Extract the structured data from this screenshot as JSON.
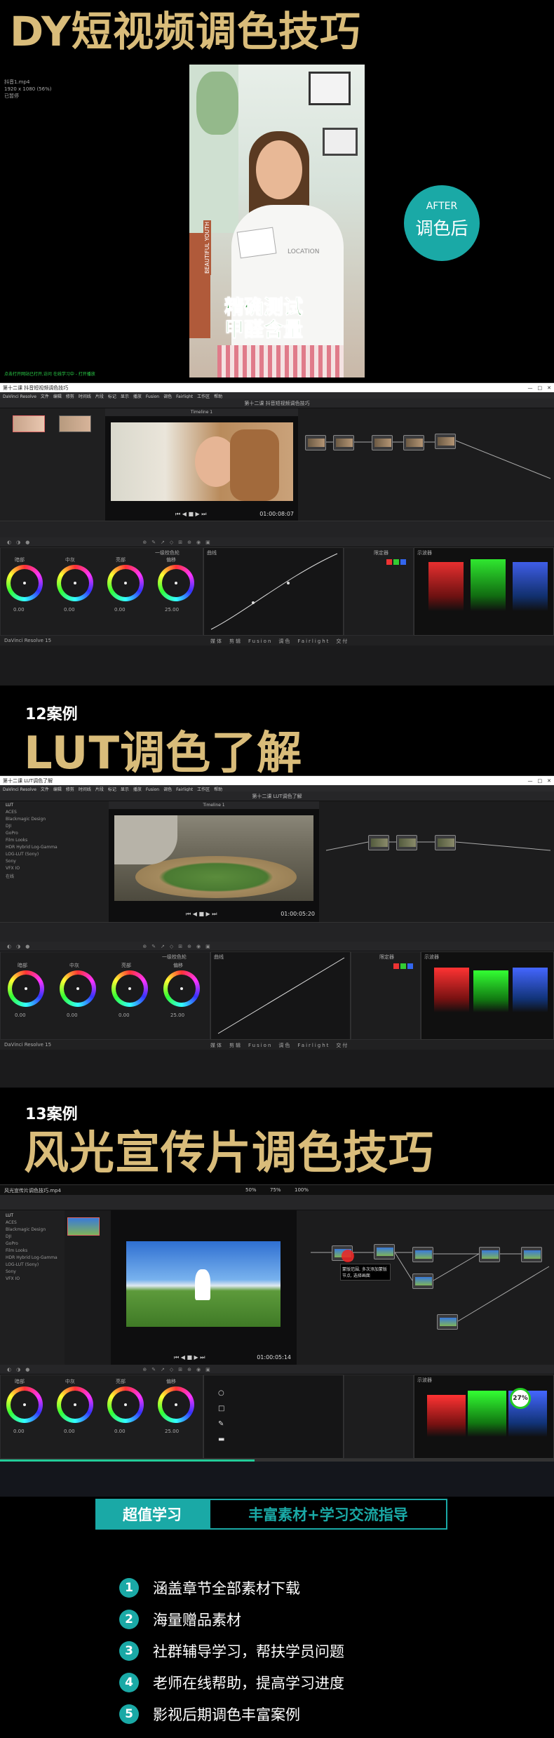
{
  "title1": "DY短视频调色技巧",
  "top_info": {
    "file": "抖音1.mp4",
    "res": "1920 x 1080 (56%)",
    "status": "已暂停",
    "link": "点击打开网站已打开,访问 在线学习中 - 打开播放"
  },
  "after_badge": {
    "line1": "AFTER",
    "line2": "调色后"
  },
  "video_caption": {
    "line1": "精确测试",
    "line2": "甲醛含量"
  },
  "shirt_text": {
    "a": "LOCATION",
    "b": "BEAUTIFUL YOUTH"
  },
  "section2": {
    "label": "12案例",
    "title": "LUT调色了解"
  },
  "section3": {
    "label": "13案例",
    "title": "风光宣传片调色技巧"
  },
  "screen1": {
    "title": "第十二课 抖音短视频调色技巧",
    "timecode": "01:00:08:07",
    "timeline": "Timeline 1",
    "app": "DaVinci Resolve 15"
  },
  "screen2": {
    "title": "第十二课 LUT调色了解",
    "timecode": "01:00:05:20",
    "timeline": "Timeline 1",
    "app": "DaVinci Resolve 15",
    "lut_items": [
      "LUT",
      "ACES",
      "Blackmagic Design",
      "DJI",
      "GoPro",
      "Film Looks",
      "HDR Hybrid Log-Gamma",
      "LOG-LUT (Sony)",
      "Sony",
      "VFX IO",
      "在线"
    ]
  },
  "screen3": {
    "file": "风光宣传片调色技巧.mp4",
    "pct1": "50%",
    "pct2": "75%",
    "pct3": "100%",
    "timecode": "01:00:05:14",
    "tooltip": "蒙版范围,  多次添加蒙版节点,  选择画面",
    "badge": "27%",
    "lut_items": [
      "LUT",
      "ACES",
      "Blackmagic Design",
      "DJI",
      "GoPro",
      "Film Looks",
      "HDR Hybrid Log-Gamma",
      "LOG-LUT (Sony)",
      "Sony",
      "VFX IO"
    ]
  },
  "wheels": {
    "labels": [
      "暗部",
      "中灰",
      "亮部",
      "偏移"
    ],
    "values": [
      "0.00",
      "0.00",
      "0.00",
      "25.00"
    ]
  },
  "panels": {
    "curves": "曲线",
    "scope": "示波器",
    "primaries": "一级校色轮",
    "keyer": "限定器",
    "pages": [
      "媒体",
      "剪辑",
      "Fusion",
      "调色",
      "Fairlight",
      "交付"
    ]
  },
  "cta": {
    "left": "超值学习",
    "right": "丰富素材+学习交流指导"
  },
  "features": [
    {
      "n": "1",
      "text": "涵盖章节全部素材下载"
    },
    {
      "n": "2",
      "text": "海量赠品素材"
    },
    {
      "n": "3",
      "text": "社群辅导学习，帮扶学员问题"
    },
    {
      "n": "4",
      "text": "老师在线帮助，提高学习进度"
    },
    {
      "n": "5",
      "text": "影视后期调色丰富案例"
    }
  ],
  "colors": {
    "gold": "#d9bc7a",
    "teal": "#1aa9a6",
    "bg": "#000000"
  }
}
